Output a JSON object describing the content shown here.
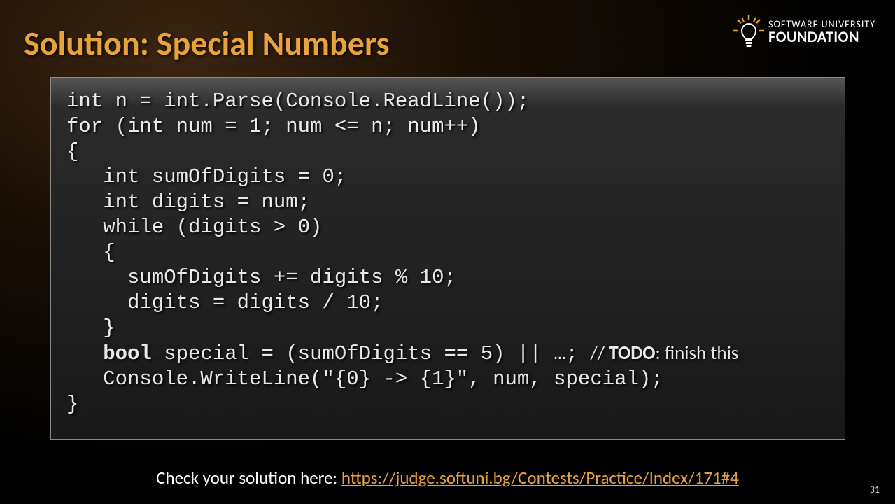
{
  "title": "Solution: Special Numbers",
  "logo": {
    "line1": "SOFTWARE UNIVERSITY",
    "line2": "FOUNDATION"
  },
  "code": {
    "l1": "int n = int.Parse(Console.ReadLine());",
    "l2": "for (int num = 1; num <= n; num++)",
    "l3": "{",
    "l4": "   int sumOfDigits = 0;",
    "l5": "   int digits = num;",
    "l6": "   while (digits > 0)",
    "l7": "   {",
    "l8": "     sumOfDigits += digits % 10;",
    "l9": "     digits = digits / 10;",
    "l10": "   }",
    "l11a": "   bool",
    "l11b": " special",
    "l11c": " = (sumOfDigits == 5) || …; ",
    "l11d": "// ",
    "l11e": "TODO",
    "l11f": ": finish this",
    "l12": "   Console.WriteLine(\"{0} -> {1}\", num, special);",
    "l13": "}"
  },
  "footer": {
    "text": "Check your solution here: ",
    "link": "https://judge.softuni.bg/Contests/Practice/Index/171#4"
  },
  "page": "31"
}
